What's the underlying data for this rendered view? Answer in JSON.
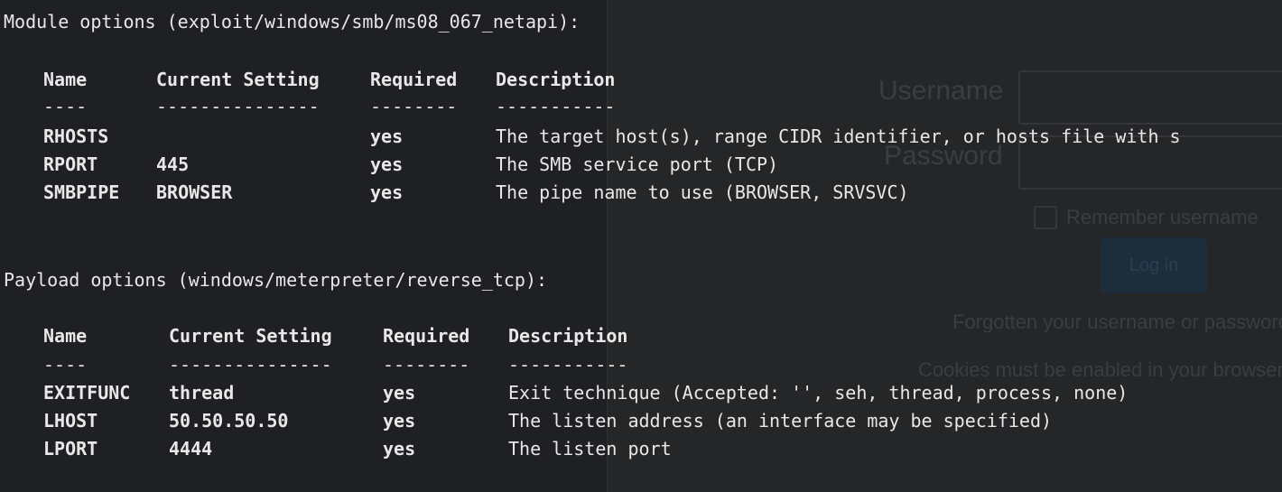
{
  "background_login": {
    "username_label": "Username",
    "password_label": "Password",
    "remember_label": "Remember username",
    "login_button": "Log in",
    "forgotten_text": "Forgotten your username or password?",
    "cookies_text": "Cookies must be enabled in your browser"
  },
  "module": {
    "heading": "Module options (exploit/windows/smb/ms08_067_netapi):",
    "columns": [
      "Name",
      "Current Setting",
      "Required",
      "Description"
    ],
    "underlines": [
      "----",
      "---------------",
      "--------",
      "-----------"
    ],
    "rows": [
      {
        "name": "RHOSTS",
        "setting": "",
        "required": "yes",
        "description": "The target host(s), range CIDR identifier, or hosts file with s"
      },
      {
        "name": "RPORT",
        "setting": "445",
        "required": "yes",
        "description": "The SMB service port (TCP)"
      },
      {
        "name": "SMBPIPE",
        "setting": "BROWSER",
        "required": "yes",
        "description": "The pipe name to use (BROWSER, SRVSVC)"
      }
    ]
  },
  "payload": {
    "heading": "Payload options (windows/meterpreter/reverse_tcp):",
    "columns": [
      "Name",
      "Current Setting",
      "Required",
      "Description"
    ],
    "underlines": [
      "----",
      "---------------",
      "--------",
      "-----------"
    ],
    "rows": [
      {
        "name": "EXITFUNC",
        "setting": "thread",
        "required": "yes",
        "description": "Exit technique (Accepted: '', seh, thread, process, none)"
      },
      {
        "name": "LHOST",
        "setting": "50.50.50.50",
        "required": "yes",
        "description": "The listen address (an interface may be specified)"
      },
      {
        "name": "LPORT",
        "setting": "4444",
        "required": "yes",
        "description": "The listen port"
      }
    ]
  },
  "colors": {
    "terminal_bg": "#1f2024",
    "terminal_text": "#e8e8e8",
    "login_bg": "#252628",
    "login_button": "#1d2d3c"
  }
}
